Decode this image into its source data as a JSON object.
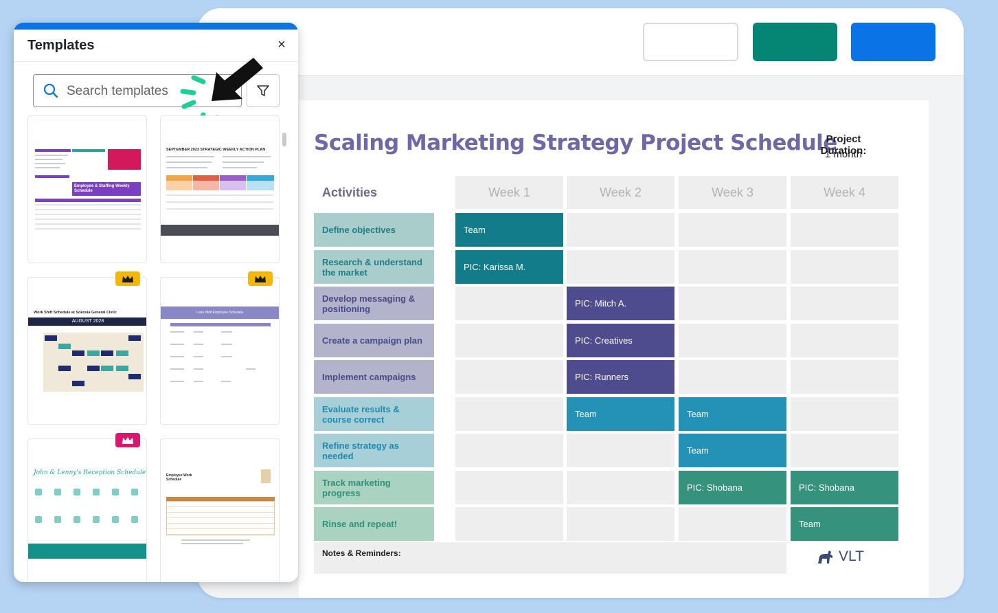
{
  "panel": {
    "title": "Templates",
    "close_label": "×",
    "search_placeholder": "Search templates",
    "templates": [
      {
        "caption": "Employee & Staffing Weekly Schedule",
        "premium": false
      },
      {
        "caption": "SEPTEMBER 2023 STRATEGIC WEEKLY ACTION PLAN",
        "premium": false
      },
      {
        "caption": "Work Shift Schedule at Sokovia General Clinic",
        "sub": "AUGUST 2028",
        "premium": true
      },
      {
        "caption": "Lone Wolf Employee Schedule",
        "premium": true
      },
      {
        "caption": "John & Lenny's Reception Schedule",
        "premium": true
      },
      {
        "caption": "Employee Work Schedule",
        "premium": false
      }
    ]
  },
  "document": {
    "title": "Scaling Marketing Strategy Project Schedule",
    "duration_label": "Project Duration:",
    "duration_value": "1 month",
    "activities_heading": "Activities",
    "weeks": [
      "Week 1",
      "Week 2",
      "Week 3",
      "Week 4"
    ],
    "rows": [
      {
        "activity": "Define objectives",
        "style": "teal",
        "cells": [
          {
            "text": "Team",
            "color": "#127c8a"
          },
          null,
          null,
          null
        ]
      },
      {
        "activity": "Research & understand the market",
        "style": "teal",
        "cells": [
          {
            "text": "PIC: Karissa M.",
            "color": "#127c8a"
          },
          null,
          null,
          null
        ]
      },
      {
        "activity": "Develop messaging & positioning",
        "style": "purple",
        "cells": [
          null,
          {
            "text": "PIC: Mitch A.",
            "color": "#4f4b8f"
          },
          null,
          null
        ]
      },
      {
        "activity": "Create a campaign plan",
        "style": "purple",
        "cells": [
          null,
          {
            "text": "PIC: Creatives",
            "color": "#4f4b8f"
          },
          null,
          null
        ]
      },
      {
        "activity": "Implement campaigns",
        "style": "purple",
        "cells": [
          null,
          {
            "text": "PIC: Runners",
            "color": "#4f4b8f"
          },
          null,
          null
        ]
      },
      {
        "activity": "Evaluate results & course correct",
        "style": "blue",
        "cells": [
          null,
          {
            "text": "Team",
            "color": "#2491b6"
          },
          {
            "text": "Team",
            "color": "#2491b6"
          },
          null
        ]
      },
      {
        "activity": "Refine strategy as needed",
        "style": "blue",
        "cells": [
          null,
          null,
          {
            "text": "Team",
            "color": "#2491b6"
          },
          null
        ]
      },
      {
        "activity": "Track marketing progress",
        "style": "green",
        "cells": [
          null,
          null,
          {
            "text": "PIC: Shobana",
            "color": "#35927c"
          },
          {
            "text": "PIC: Shobana",
            "color": "#35927c"
          }
        ]
      },
      {
        "activity": "Rinse and repeat!",
        "style": "green",
        "cells": [
          null,
          null,
          null,
          {
            "text": "Team",
            "color": "#35927c"
          }
        ]
      }
    ],
    "notes_label": "Notes & Reminders:",
    "brand": "VLT"
  },
  "colors": {
    "accent_blue": "#0a73e6",
    "accent_green": "#058574",
    "title_purple": "#6e68a6",
    "crown_yellow": "#f5b700",
    "crown_pink": "#d6196e",
    "activity_styles": {
      "teal": {
        "bg": "#a9cdcb",
        "fg": "#1f7f86"
      },
      "purple": {
        "bg": "#b3b3cc",
        "fg": "#4a4a88"
      },
      "blue": {
        "bg": "#a6cfd8",
        "fg": "#1f8ab0"
      },
      "green": {
        "bg": "#a9d2c1",
        "fg": "#2f9278"
      }
    }
  }
}
